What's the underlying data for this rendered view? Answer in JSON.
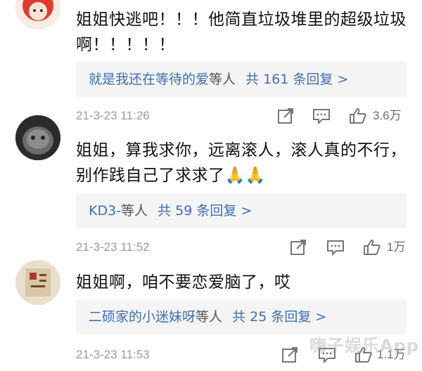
{
  "comments": [
    {
      "username": "",
      "text": "姐姐快逃吧！！！他简直垃圾堆里的超级垃圾啊！！！！！",
      "reply_user": "就是我还在等待的爱",
      "reply_mid": "等人",
      "reply_count": "共 161 条回复 >",
      "timestamp": "21-3-23 11:26",
      "likes": "3.6万",
      "avatar_icon": "red-cartoon-avatar"
    },
    {
      "username": "",
      "text": "姐姐，算我求你，远离滚人，滚人真的不行，别作践自己了求求了🙏🙏",
      "reply_user": "KD3-",
      "reply_mid": "等人",
      "reply_count": "共 59 条回复 >",
      "timestamp": "21-3-23 11:52",
      "likes": "1万",
      "avatar_icon": "cat-photo-avatar"
    },
    {
      "username": "",
      "text": "姐姐啊，咱不要恋爱脑了，哎",
      "reply_user": "二硕家的小迷妹呀",
      "reply_mid": "等人",
      "reply_count": "共 25 条回复 >",
      "timestamp": "21-3-23 11:53",
      "likes": "1.1万",
      "avatar_icon": "calligraphy-avatar"
    }
  ],
  "watermark": "嗨子娱乐App",
  "colors": {
    "link": "#3d6fb3",
    "reply_bg": "#f4f4f4",
    "meta": "#9a9a9a"
  }
}
